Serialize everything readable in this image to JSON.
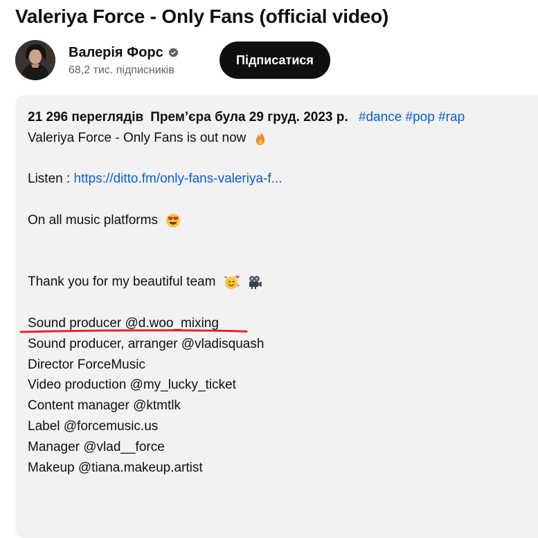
{
  "video": {
    "title": "Valeriya Force - Only Fans (official video)"
  },
  "channel": {
    "name": "Валерія Форс",
    "subscribers": "68,2 тис. підписників",
    "subscribe_label": "Підписатися"
  },
  "description": {
    "views": "21 296 переглядів",
    "premiere": "Прем’єра була 29 груд. 2023 р.",
    "hashtags": [
      "#dance",
      "#pop",
      "#rap"
    ],
    "intro": "Valeriya Force - Only Fans is out now",
    "listen_label": "Listen :",
    "listen_link": "https://ditto.fm/only-fans-valeriya-f...",
    "platforms": "On all music platforms",
    "thanks": "Thank you for my beautiful team",
    "credits": [
      "Sound producer @d.woo_mixing",
      "Sound producer, arranger @vladisquash",
      "Director ForceMusic",
      "Video production @my_lucky_ticket",
      "Content manager @ktmtlk",
      "Label @forcemusic.us",
      "Manager @vlad__force",
      "Makeup @tiana.makeup.artist"
    ]
  },
  "icons": {
    "verified": "verified-badge-icon",
    "fire": "fire-emoji-icon",
    "heart_eyes": "heart-eyes-emoji-icon",
    "hug": "smiling-face-with-hearts-emoji-icon",
    "camera": "movie-camera-emoji-icon"
  },
  "colors": {
    "link": "#065fd4",
    "button_bg": "#0f0f0f",
    "panel_bg": "#f2f2f2",
    "annotation": "#e3262e"
  }
}
